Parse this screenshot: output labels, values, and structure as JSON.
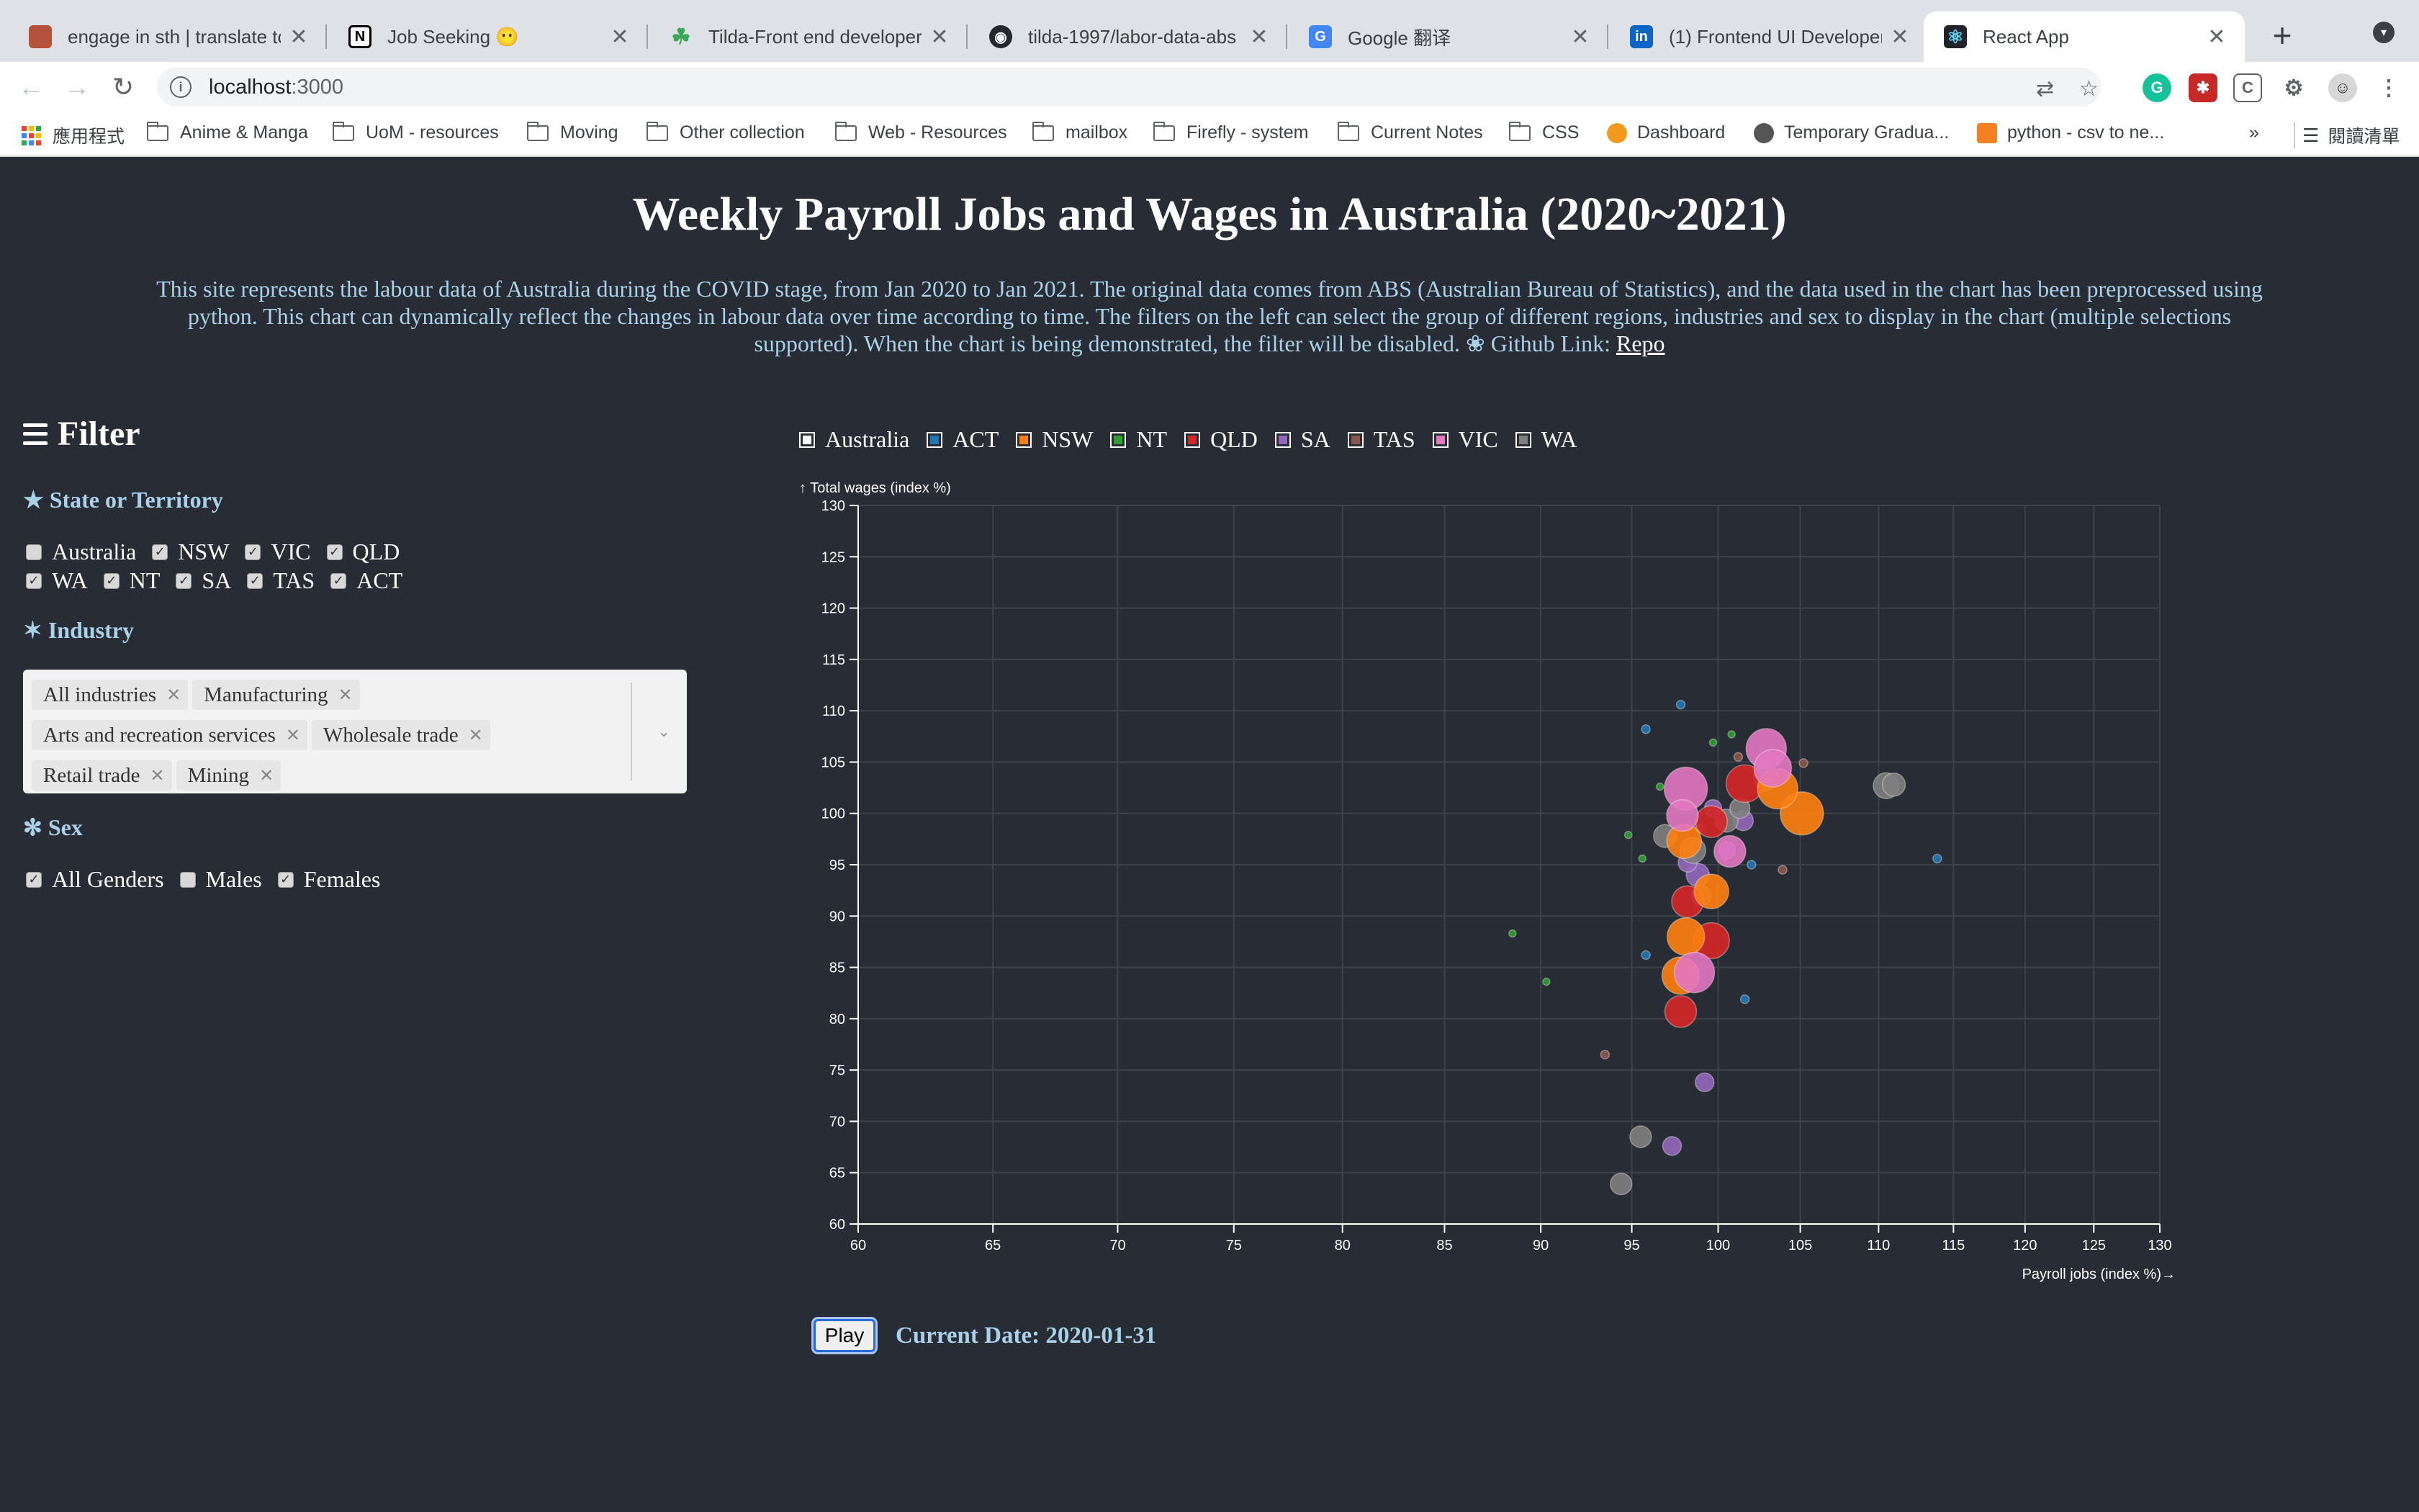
{
  "browser": {
    "tabs": [
      {
        "title": "engage in sth | translate to t",
        "favicon": "cambridge-icon",
        "color": "#b5523b"
      },
      {
        "title": "Job Seeking 😶",
        "favicon": "notion-icon",
        "color": "#000000"
      },
      {
        "title": "Tilda-Front end developer -",
        "favicon": "leaf-icon",
        "color": "#3aa757"
      },
      {
        "title": "tilda-1997/labor-data-abs",
        "favicon": "github-icon",
        "color": "#24292e"
      },
      {
        "title": "Google 翻译",
        "favicon": "google-translate-icon",
        "color": "#4285f4"
      },
      {
        "title": "(1) Frontend UI Developer |",
        "favicon": "linkedin-icon",
        "color": "#0a66c2"
      },
      {
        "title": "React App",
        "favicon": "react-icon",
        "color": "#20232a"
      }
    ],
    "url_host": "localhost",
    "url_port": ":3000",
    "bookmarks": [
      {
        "label": "應用程式",
        "kind": "apps"
      },
      {
        "label": "Anime & Manga",
        "kind": "folder"
      },
      {
        "label": "UoM - resources",
        "kind": "folder"
      },
      {
        "label": "Moving",
        "kind": "folder"
      },
      {
        "label": "Other collection",
        "kind": "folder"
      },
      {
        "label": "Web - Resources",
        "kind": "folder"
      },
      {
        "label": "mailbox",
        "kind": "folder"
      },
      {
        "label": "Firefly - system",
        "kind": "folder"
      },
      {
        "label": "Current Notes",
        "kind": "folder"
      },
      {
        "label": "CSS",
        "kind": "folder"
      },
      {
        "label": "Dashboard",
        "kind": "site"
      },
      {
        "label": "Temporary Gradua...",
        "kind": "site"
      },
      {
        "label": "python - csv to ne...",
        "kind": "site"
      }
    ],
    "bookmarks_more": "»",
    "reading_list": "閱讀清單"
  },
  "app": {
    "title": "Weekly Payroll Jobs and Wages in Australia (2020~2021)",
    "description": "This site represents the labour data of Australia during the COVID stage, from Jan 2020 to Jan 2021. The original data comes from ABS (Australian Bureau of Statistics), and the data used in the chart has been preprocessed using python. This chart can dynamically reflect the changes in labour data over time according to time. The filters on the left can select the group of different regions, industries and sex to display in the chart (multiple selections supported). When the chart is being demonstrated, the filter will be disabled. ❀ Github Link: ",
    "repo_link": "Repo",
    "filter": {
      "title": "Filter",
      "state_title": "★ State or Territory",
      "states": [
        {
          "label": "Australia",
          "checked": false
        },
        {
          "label": "NSW",
          "checked": true
        },
        {
          "label": "VIC",
          "checked": true
        },
        {
          "label": "QLD",
          "checked": true
        },
        {
          "label": "WA",
          "checked": true
        },
        {
          "label": "NT",
          "checked": true
        },
        {
          "label": "SA",
          "checked": true
        },
        {
          "label": "TAS",
          "checked": true
        },
        {
          "label": "ACT",
          "checked": true
        }
      ],
      "industry_title": "✶ Industry",
      "industries": [
        "All industries",
        "Manufacturing",
        "Arts and recreation services",
        "Wholesale trade",
        "Retail trade",
        "Mining"
      ],
      "sex_title": "✻ Sex",
      "sexes": [
        {
          "label": "All Genders",
          "checked": true
        },
        {
          "label": "Males",
          "checked": false
        },
        {
          "label": "Females",
          "checked": true
        }
      ]
    },
    "play_label": "Play",
    "current_date_label": "Current Date: 2020-01-31"
  },
  "chart_data": {
    "type": "scatter",
    "xlabel": "Payroll jobs (index %)→",
    "ylabel": "↑ Total wages (index %)",
    "xlim": [
      60,
      130
    ],
    "ylim": [
      60,
      130
    ],
    "x_scale": "log",
    "x_ticks": [
      60,
      65,
      70,
      75,
      80,
      85,
      90,
      95,
      100,
      105,
      110,
      115,
      120,
      125,
      130
    ],
    "y_ticks": [
      60,
      65,
      70,
      75,
      80,
      85,
      90,
      95,
      100,
      105,
      110,
      115,
      120,
      125,
      130
    ],
    "grid": true,
    "legend": [
      {
        "name": "Australia",
        "color": "#ffffff"
      },
      {
        "name": "ACT",
        "color": "#1f77b4"
      },
      {
        "name": "NSW",
        "color": "#ff7f0e"
      },
      {
        "name": "NT",
        "color": "#2ca02c"
      },
      {
        "name": "QLD",
        "color": "#d62728"
      },
      {
        "name": "SA",
        "color": "#9467bd"
      },
      {
        "name": "TAS",
        "color": "#8c564b"
      },
      {
        "name": "VIC",
        "color": "#e377c2"
      },
      {
        "name": "WA",
        "color": "#7f7f7f"
      }
    ],
    "series": [
      {
        "name": "ACT",
        "color": "#1f77b4",
        "points": [
          [
            97.8,
            110.6,
            6
          ],
          [
            95.8,
            108.2,
            6
          ],
          [
            113.9,
            95.6,
            6
          ],
          [
            101.6,
            81.9,
            6
          ],
          [
            95.8,
            86.2,
            6
          ],
          [
            102.0,
            95.0,
            6
          ]
        ]
      },
      {
        "name": "NT",
        "color": "#2ca02c",
        "points": [
          [
            88.5,
            88.3,
            5
          ],
          [
            90.3,
            83.6,
            5
          ],
          [
            94.8,
            97.9,
            5
          ],
          [
            99.7,
            106.9,
            5
          ],
          [
            100.8,
            107.7,
            5
          ],
          [
            96.6,
            102.6,
            5
          ],
          [
            95.6,
            95.6,
            5
          ]
        ]
      },
      {
        "name": "TAS",
        "color": "#8c564b",
        "points": [
          [
            93.5,
            76.5,
            6
          ],
          [
            103.9,
            94.5,
            6
          ],
          [
            105.2,
            104.9,
            6
          ],
          [
            101.2,
            105.5,
            6
          ],
          [
            98.9,
            98.5,
            6
          ]
        ]
      },
      {
        "name": "SA",
        "color": "#9467bd",
        "points": [
          [
            99.2,
            73.8,
            13
          ],
          [
            97.3,
            67.6,
            13
          ],
          [
            99.0,
            92.0,
            14
          ],
          [
            98.8,
            94.0,
            16
          ],
          [
            101.5,
            99.3,
            14
          ],
          [
            99.7,
            100.5,
            12
          ],
          [
            100.5,
            96.4,
            12
          ],
          [
            98.2,
            95.2,
            13
          ]
        ]
      },
      {
        "name": "WA",
        "color": "#7f7f7f",
        "points": [
          [
            95.5,
            68.5,
            15
          ],
          [
            94.4,
            63.9,
            15
          ],
          [
            110.5,
            102.7,
            18
          ],
          [
            111.0,
            102.8,
            16
          ],
          [
            98.5,
            96.4,
            18
          ],
          [
            96.9,
            97.8,
            16
          ],
          [
            100.5,
            99.3,
            16
          ],
          [
            102.9,
            103.5,
            18
          ],
          [
            101.3,
            100.5,
            14
          ]
        ]
      },
      {
        "name": "QLD",
        "color": "#d62728",
        "points": [
          [
            97.8,
            80.7,
            22
          ],
          [
            99.6,
            87.6,
            25
          ],
          [
            98.2,
            91.4,
            22
          ],
          [
            101.6,
            102.9,
            26
          ],
          [
            99.6,
            99.2,
            22
          ]
        ]
      },
      {
        "name": "NSW",
        "color": "#ff7f0e",
        "points": [
          [
            97.8,
            84.2,
            26
          ],
          [
            98.1,
            88.0,
            26
          ],
          [
            105.1,
            100.0,
            30
          ],
          [
            103.6,
            102.4,
            28
          ],
          [
            98.0,
            97.3,
            24
          ],
          [
            99.6,
            92.4,
            24
          ]
        ]
      },
      {
        "name": "VIC",
        "color": "#e377c2",
        "points": [
          [
            98.6,
            84.5,
            28
          ],
          [
            98.1,
            102.4,
            30
          ],
          [
            102.9,
            106.3,
            28
          ],
          [
            103.3,
            104.4,
            26
          ],
          [
            100.7,
            96.3,
            22
          ],
          [
            97.9,
            99.8,
            22
          ]
        ]
      }
    ]
  }
}
